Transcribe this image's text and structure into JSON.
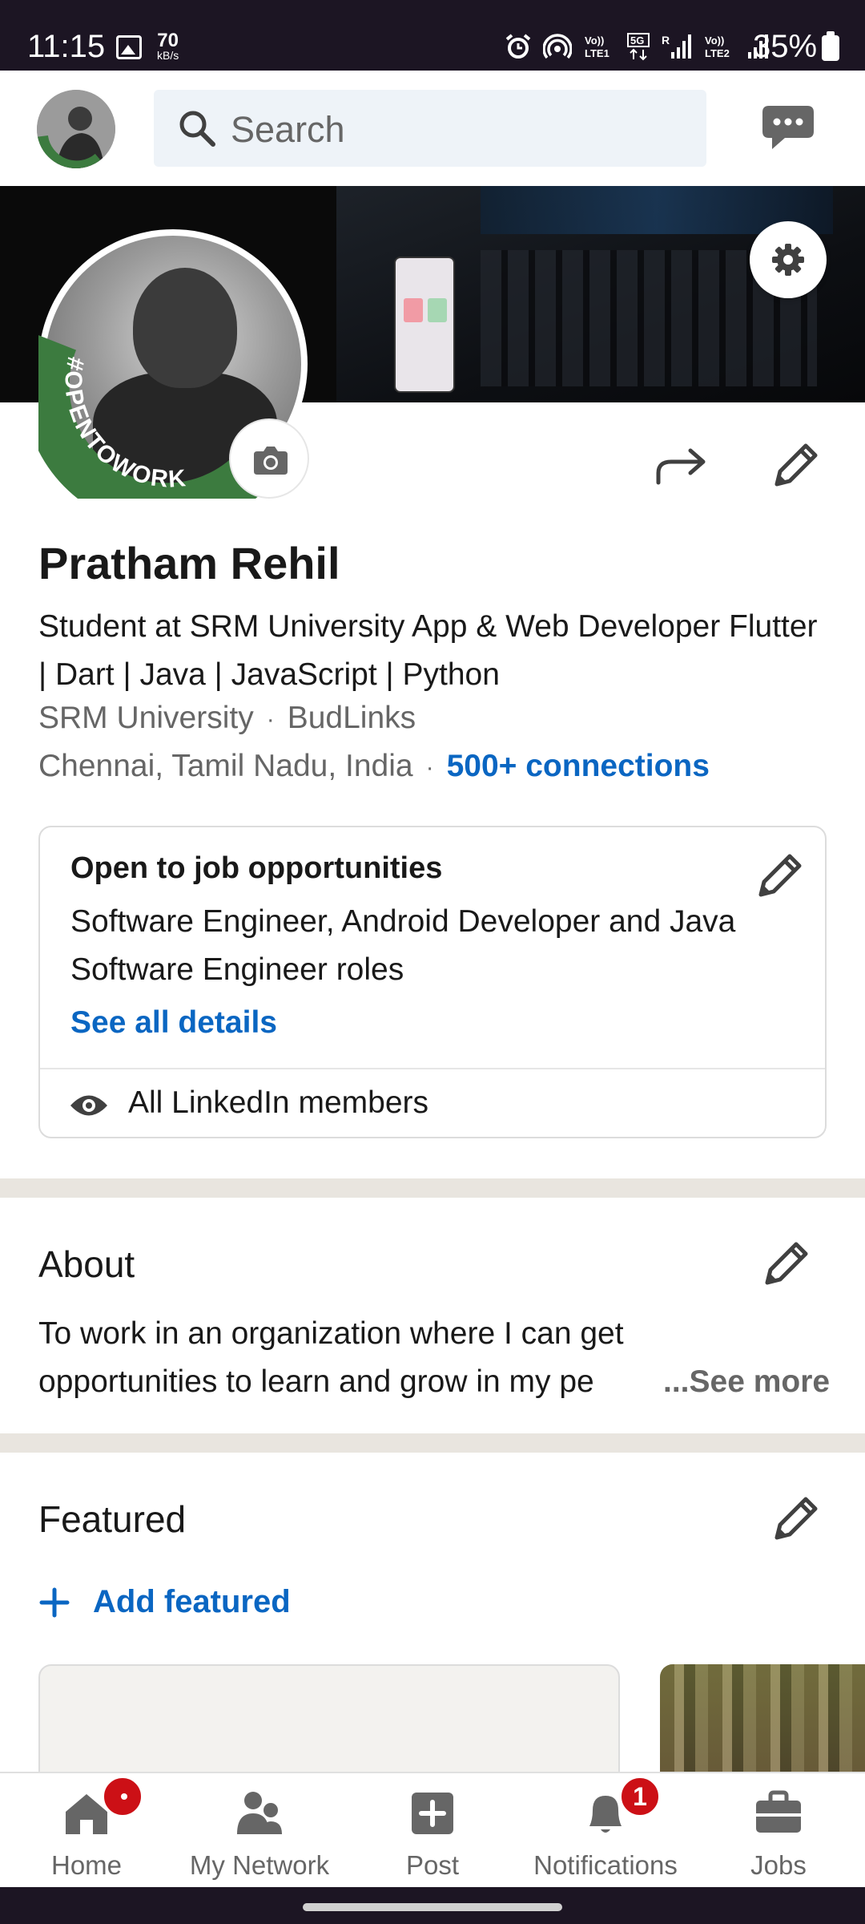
{
  "status_bar": {
    "time": "11:15",
    "speed_value": "70",
    "speed_unit": "kB/s",
    "lte1": "Vo))\nLTE1",
    "net": "5G",
    "lte2": "Vo))\nLTE2",
    "battery": "35%"
  },
  "top_bar": {
    "search_placeholder": "Search"
  },
  "profile": {
    "open_to_work_ring": "#OPENTOWORK",
    "name": "Pratham Rehil",
    "headline": "Student at SRM University App & Web Developer Flutter | Dart | Java | JavaScript | Python",
    "education": "SRM University",
    "company": "BudLinks",
    "location": "Chennai, Tamil Nadu, India",
    "connections": "500+ connections",
    "separator": "·"
  },
  "open_to_work_card": {
    "title": "Open to job opportunities",
    "roles": "Software Engineer, Android Developer and Java Software Engineer roles",
    "link": "See all details",
    "visibility": "All LinkedIn members"
  },
  "about": {
    "title": "About",
    "text": "To work in an organization where I can get opportunities to learn and grow in my pe",
    "see_more": "...See more"
  },
  "featured": {
    "title": "Featured",
    "add_label": "Add featured"
  },
  "bottom_nav": {
    "items": [
      {
        "label": "Home",
        "icon": "home-icon",
        "badge": "dot"
      },
      {
        "label": "My Network",
        "icon": "network-icon"
      },
      {
        "label": "Post",
        "icon": "post-icon"
      },
      {
        "label": "Notifications",
        "icon": "bell-icon",
        "badge": "1"
      },
      {
        "label": "Jobs",
        "icon": "briefcase-icon"
      }
    ]
  },
  "colors": {
    "accent": "#0a66c2",
    "badge": "#cc1016",
    "open_to_work_green": "#3c7b3f",
    "status_bar": "#1c1523"
  }
}
